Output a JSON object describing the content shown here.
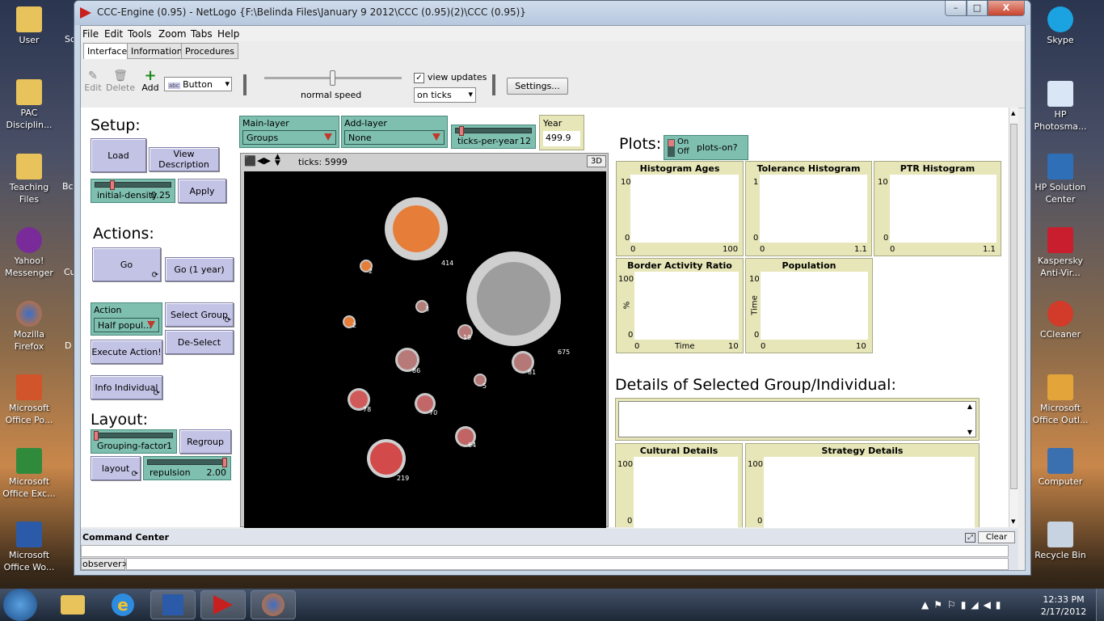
{
  "desktop": {
    "left": [
      {
        "label": "User",
        "sub": ""
      },
      {
        "label": "PAC",
        "sub": "Disciplin..."
      },
      {
        "label": "Teaching",
        "sub": "Files"
      },
      {
        "label": "Yahoo!",
        "sub": "Messenger"
      },
      {
        "label": "Mozilla",
        "sub": "Firefox"
      },
      {
        "label": "Microsoft",
        "sub": "Office Po..."
      },
      {
        "label": "Microsoft",
        "sub": "Office Exc..."
      },
      {
        "label": "Microsoft",
        "sub": "Office Wo..."
      }
    ],
    "right": [
      {
        "label": "Skype",
        "sub": ""
      },
      {
        "label": "HP",
        "sub": "Photosma..."
      },
      {
        "label": "HP Solution",
        "sub": "Center"
      },
      {
        "label": "Kaspersky",
        "sub": "Anti-Vir..."
      },
      {
        "label": "CCleaner",
        "sub": ""
      },
      {
        "label": "Microsoft",
        "sub": "Office Outl..."
      },
      {
        "label": "Computer",
        "sub": ""
      },
      {
        "label": "Recycle Bin",
        "sub": ""
      }
    ],
    "partial": [
      "Sc",
      "Bc",
      "Cu",
      "D"
    ]
  },
  "window": {
    "title": "CCC-Engine (0.95) - NetLogo {F:\\Belinda Files\\January 9 2012\\CCC (0.95)(2)\\CCC (0.95)}",
    "min": "–",
    "max": "□",
    "close": "X"
  },
  "menu": [
    "File",
    "Edit",
    "Tools",
    "Zoom",
    "Tabs",
    "Help"
  ],
  "tabs": [
    "Interface",
    "Information",
    "Procedures"
  ],
  "toolbar": {
    "edit": "Edit",
    "delete": "Delete",
    "add": "Add",
    "widget": "Button",
    "abc": "abc",
    "speed": "normal speed",
    "view_updates": "view updates",
    "update_mode": "on ticks",
    "settings": "Settings..."
  },
  "left": {
    "setup": "Setup:",
    "load": "Load",
    "view_description": "View Description",
    "density_label": "initial-density",
    "density_value": "0.25",
    "apply": "Apply",
    "actions": "Actions:",
    "go": "Go",
    "go_year": "Go (1 year)",
    "action_label": "Action",
    "action_value": "Half popul...",
    "select_group": "Select Group",
    "execute": "Execute Action!",
    "deselect": "De-Select",
    "info_individual": "Info Individual",
    "layout": "Layout:",
    "grouping_label": "Grouping-factor",
    "grouping_value": "1",
    "regroup": "Regroup",
    "layout_btn": "layout",
    "repulsion_label": "repulsion",
    "repulsion_value": "2.00"
  },
  "top": {
    "main_layer_label": "Main-layer",
    "main_layer_value": "Groups",
    "add_layer_label": "Add-layer",
    "add_layer_value": "None",
    "tpy_label": "ticks-per-year",
    "tpy_value": "12",
    "year_label": "Year",
    "year_value": "499.9"
  },
  "view": {
    "ticks": "ticks: 5999",
    "three_d": "3D",
    "labels": [
      "414",
      "675",
      "2",
      "3",
      "2",
      "19",
      "86",
      "81",
      "5",
      "78",
      "70",
      "64",
      "219"
    ]
  },
  "plots": {
    "title": "Plots:",
    "switch_on": "On",
    "switch_off": "Off",
    "switch_label": "plots-on?",
    "p1": {
      "title": "Histogram Ages",
      "ymax": "10",
      "ymin": "0",
      "xmin": "0",
      "xmax": "100"
    },
    "p2": {
      "title": "Tolerance Histogram",
      "ymax": "1",
      "ymin": "0",
      "xmin": "0",
      "xmax": "1.1"
    },
    "p3": {
      "title": "PTR Histogram",
      "ymax": "10",
      "ymin": "0",
      "xmin": "0",
      "xmax": "1.1"
    },
    "p4": {
      "title": "Border Activity Ratio",
      "ymax": "100",
      "ymin": "0",
      "xmin": "0",
      "xmax": "10",
      "ylabel": "%",
      "xlabel": "Time"
    },
    "p5": {
      "title": "Population",
      "ymax": "10",
      "ymin": "0",
      "xmin": "0",
      "xmax": "10",
      "ylabel": "Time"
    },
    "details": "Details of Selected Group/Individual:",
    "p6": {
      "title": "Cultural Details",
      "ymax": "100",
      "ymin": "0"
    },
    "p7": {
      "title": "Strategy Details",
      "ymax": "100",
      "ymin": "0"
    }
  },
  "command": {
    "title": "Command Center",
    "clear": "Clear",
    "prompt": "observer>"
  },
  "clock": {
    "time": "12:33 PM",
    "date": "2/17/2012"
  }
}
